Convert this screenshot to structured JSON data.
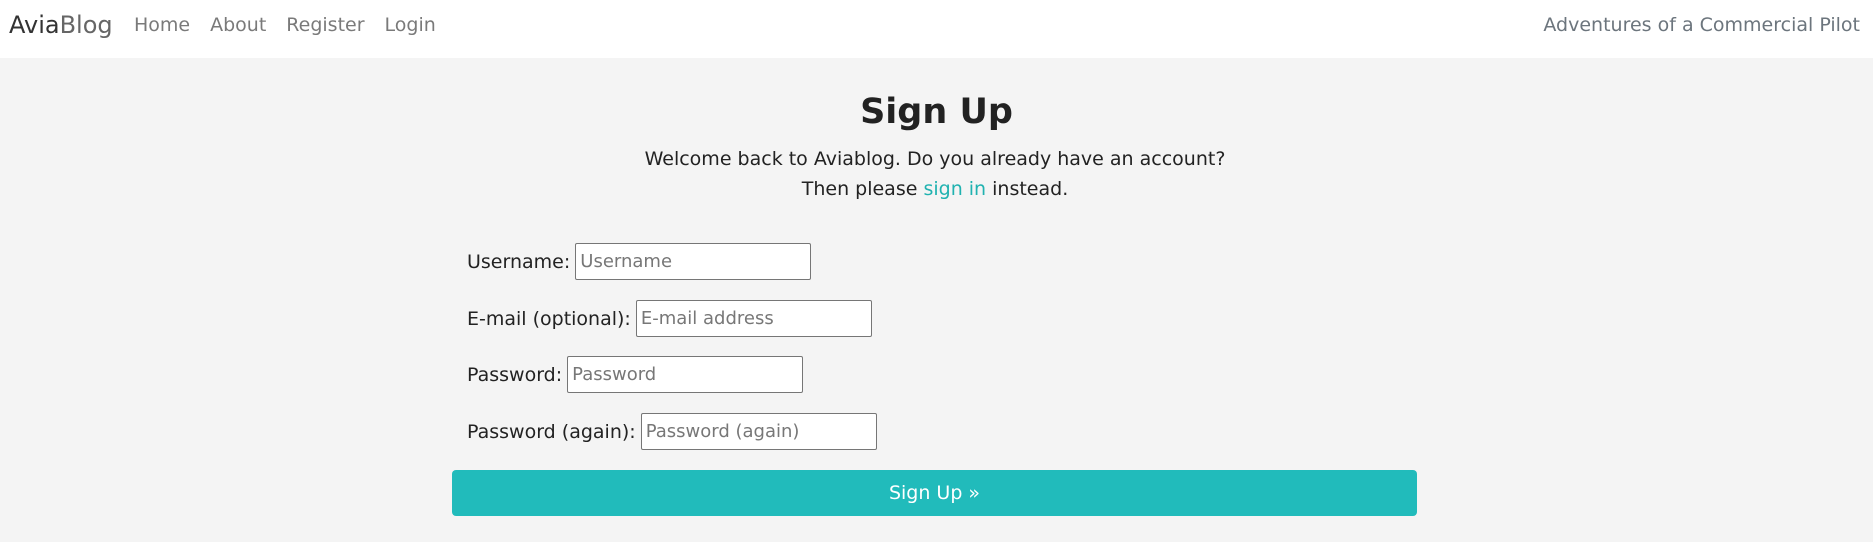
{
  "navbar": {
    "brand_part1": "Avia",
    "brand_part2": "Blog",
    "links": [
      {
        "label": "Home"
      },
      {
        "label": "About"
      },
      {
        "label": "Register"
      },
      {
        "label": "Login"
      }
    ],
    "tagline": "Adventures of a Commercial Pilot"
  },
  "page": {
    "title": "Sign Up",
    "intro_before": "Welcome back to Aviablog. Do you already have an account? Then please ",
    "intro_link": "sign in",
    "intro_after": " instead."
  },
  "form": {
    "username": {
      "label": "Username:",
      "placeholder": "Username",
      "value": ""
    },
    "email": {
      "label": "E-mail (optional):",
      "placeholder": "E-mail address",
      "value": ""
    },
    "password": {
      "label": "Password:",
      "placeholder": "Password",
      "value": ""
    },
    "password2": {
      "label": "Password (again):",
      "placeholder": "Password (again)",
      "value": ""
    },
    "submit_label": "Sign Up »"
  },
  "colors": {
    "accent": "#21bbbb",
    "link": "#20b2b0",
    "background": "#f4f4f4",
    "navbar": "#ffffff"
  }
}
